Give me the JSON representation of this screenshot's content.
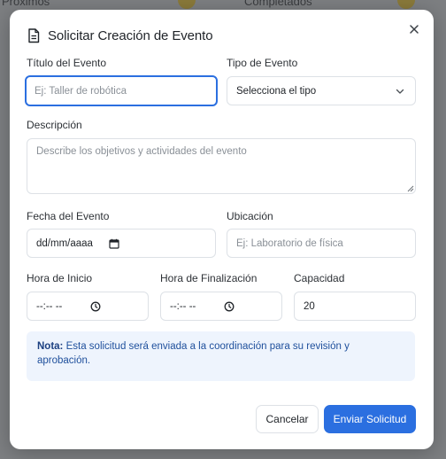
{
  "background": {
    "left_text": "Próximos",
    "right_text": "Completados"
  },
  "modal": {
    "title": "Solicitar Creación de Evento",
    "title_icon": "document-icon",
    "close_icon": "close-icon"
  },
  "form": {
    "title": {
      "label": "Título del Evento",
      "placeholder": "Ej: Taller de robótica",
      "value": ""
    },
    "type": {
      "label": "Tipo de Evento",
      "selected": "Selecciona el tipo"
    },
    "description": {
      "label": "Descripción",
      "placeholder": "Describe los objetivos y actividades del evento",
      "value": ""
    },
    "date": {
      "label": "Fecha del Evento",
      "value": "dd/mm/aaaa"
    },
    "location": {
      "label": "Ubicación",
      "placeholder": "Ej: Laboratorio de física",
      "value": ""
    },
    "start_time": {
      "label": "Hora de Inicio",
      "value": "--:-- --"
    },
    "end_time": {
      "label": "Hora de Finalización",
      "value": "--:-- --"
    },
    "capacity": {
      "label": "Capacidad",
      "value": "20"
    }
  },
  "note": {
    "prefix": "Nota:",
    "text": " Esta solicitud será enviada a la coordinación para su revisión y aprobación."
  },
  "buttons": {
    "cancel": "Cancelar",
    "submit": "Enviar Solicitud"
  },
  "colors": {
    "accent": "#2b6fe0",
    "note_bg": "#eef4fd",
    "note_text": "#1e4f9c"
  }
}
